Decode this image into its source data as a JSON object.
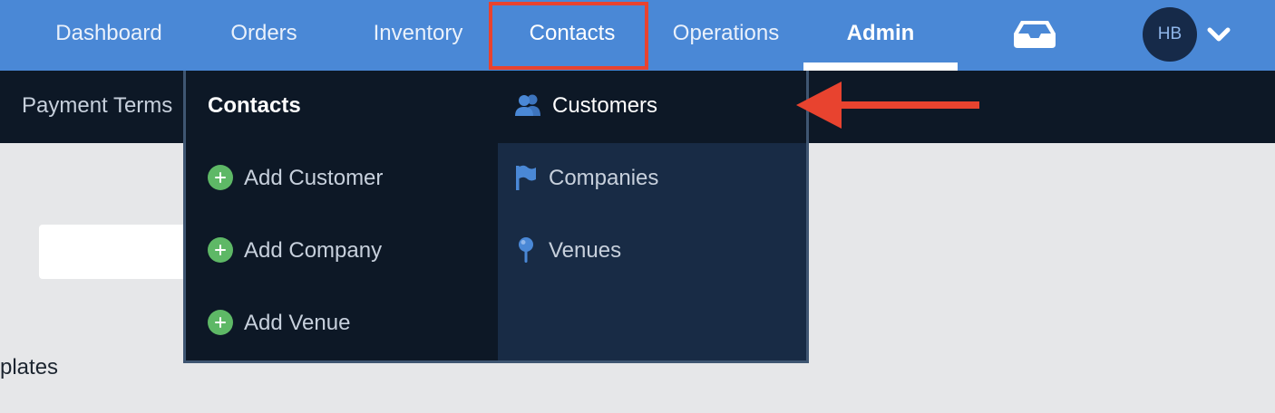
{
  "topnav": {
    "items": [
      {
        "label": "Dashboard"
      },
      {
        "label": "Orders"
      },
      {
        "label": "Inventory"
      },
      {
        "label": "Contacts"
      },
      {
        "label": "Operations"
      },
      {
        "label": "Admin"
      }
    ],
    "avatar_initials": "HB",
    "icons": [
      "inbox-icon",
      "chevron-down-icon"
    ]
  },
  "subnav": {
    "items": [
      {
        "label": "Payment Terms"
      }
    ]
  },
  "dropdown": {
    "heading": "Contacts",
    "add_actions": [
      {
        "label": "Add Customer",
        "icon": "plus-circle-icon"
      },
      {
        "label": "Add Company",
        "icon": "plus-circle-icon"
      },
      {
        "label": "Add Venue",
        "icon": "plus-circle-icon"
      }
    ],
    "links": [
      {
        "label": "Customers",
        "icon": "users-icon"
      },
      {
        "label": "Companies",
        "icon": "flag-icon"
      },
      {
        "label": "Venues",
        "icon": "pin-icon"
      }
    ]
  },
  "page": {
    "partial_text": "plates"
  },
  "colors": {
    "nav_blue": "#4a88d6",
    "dark_navy": "#0d1826",
    "panel_navy": "#182b45",
    "annotation_red": "#e8432f",
    "plus_green": "#5eb866",
    "icon_blue": "#4a88d6"
  }
}
